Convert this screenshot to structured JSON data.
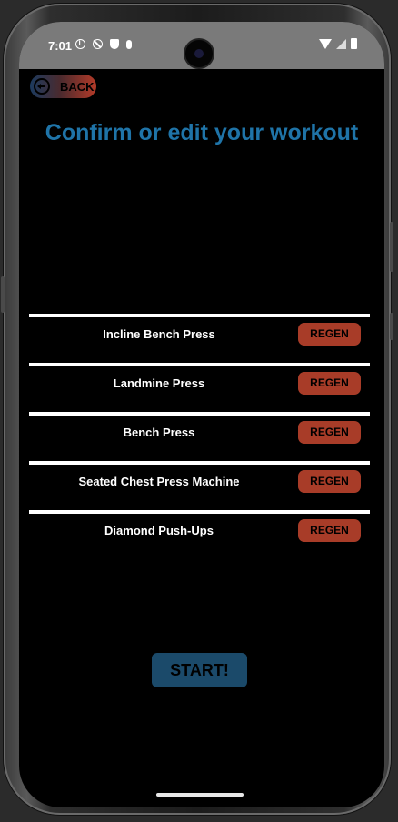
{
  "status_bar": {
    "time": "7:01"
  },
  "header": {
    "back_label": "BACK",
    "title": "Confirm or edit your workout"
  },
  "exercises": [
    {
      "name": "Incline Bench Press",
      "action_label": "REGEN"
    },
    {
      "name": "Landmine Press",
      "action_label": "REGEN"
    },
    {
      "name": "Bench Press",
      "action_label": "REGEN"
    },
    {
      "name": "Seated Chest Press Machine",
      "action_label": "REGEN"
    },
    {
      "name": "Diamond Push-Ups",
      "action_label": "REGEN"
    }
  ],
  "footer": {
    "start_label": "START!"
  },
  "colors": {
    "title": "#1f74a8",
    "regen": "#a83c28",
    "start": "#1b4a6a",
    "background": "#000000"
  }
}
